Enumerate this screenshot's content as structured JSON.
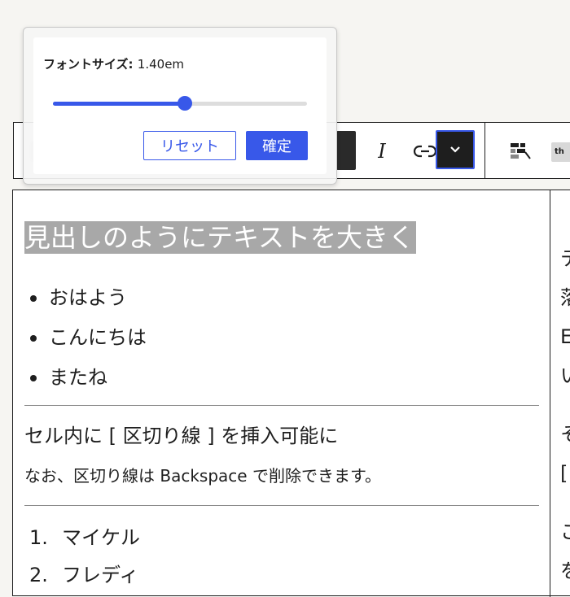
{
  "popover": {
    "font_size_label": "フォントサイズ:",
    "font_size_value": "1.40em",
    "slider_fraction": 0.52,
    "reset_label": "リセット",
    "confirm_label": "確定"
  },
  "content": {
    "heading": "見出しのようにテキストを大きく",
    "bullets": [
      "おはよう",
      "こんにちは",
      "またね"
    ],
    "para1": "セル内に [ 区切り線 ] を挿入可能に",
    "para2": "なお、区切り線は Backspace で削除できます。",
    "ordered": [
      {
        "num": "1.",
        "text": "マイケル"
      },
      {
        "num": "2.",
        "text": "フレディ"
      }
    ],
    "right_col": [
      "テ",
      "落",
      "E",
      "い",
      "そ",
      "[",
      "こ",
      "を"
    ]
  },
  "toolbar": {
    "italic_label": "I",
    "th_label": "th"
  },
  "colors": {
    "accent": "#3858e9",
    "dark": "#1e1e1e",
    "highlight": "#a8a8a8"
  }
}
